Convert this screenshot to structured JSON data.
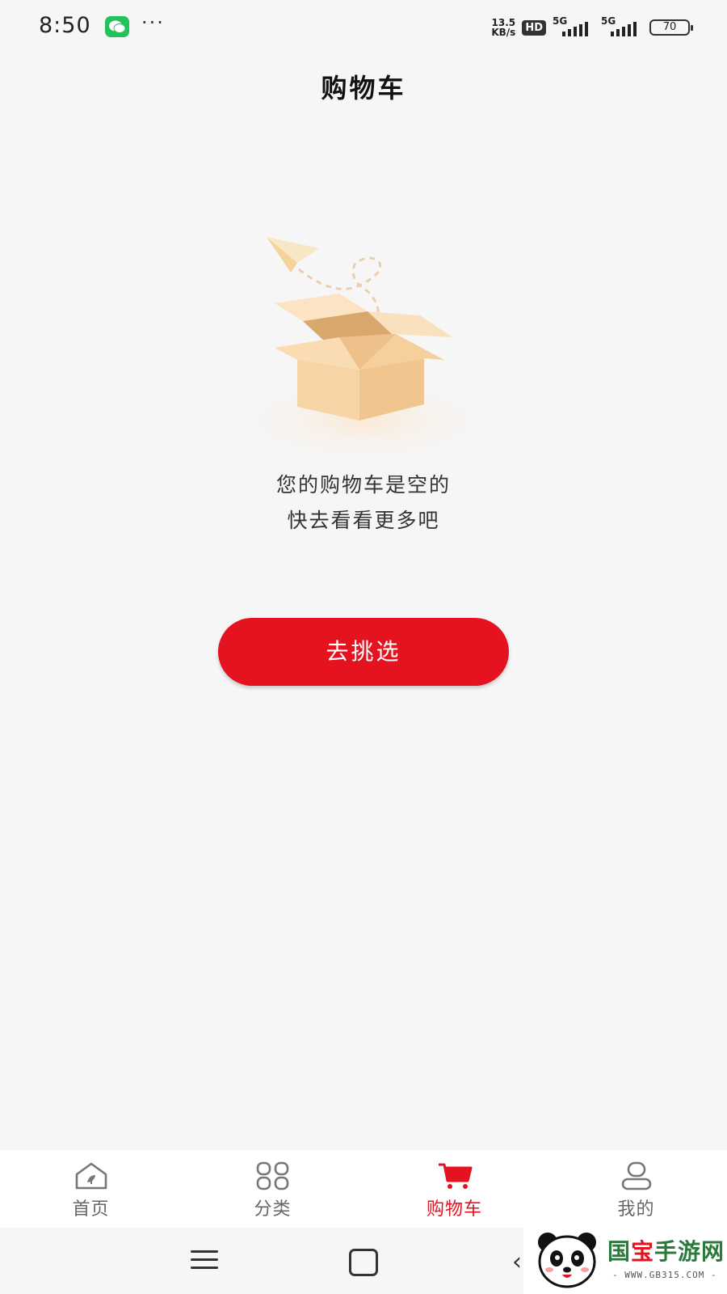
{
  "status_bar": {
    "time": "8:50",
    "more": "···",
    "net_speed_value": "13.5",
    "net_speed_unit": "KB/s",
    "hd_badge": "HD",
    "signal1_label": "5G",
    "signal2_label": "5G",
    "battery": "70"
  },
  "header": {
    "title": "购物车"
  },
  "empty_state": {
    "line1": "您的购物车是空的",
    "line2": "快去看看更多吧",
    "button_label": "去挑选"
  },
  "bottom_nav": {
    "items": [
      {
        "label": "首页",
        "icon": "home-icon",
        "active": false
      },
      {
        "label": "分类",
        "icon": "category-icon",
        "active": false
      },
      {
        "label": "购物车",
        "icon": "cart-icon",
        "active": true
      },
      {
        "label": "我的",
        "icon": "profile-icon",
        "active": false
      }
    ]
  },
  "watermark": {
    "title_part1": "国",
    "title_part2": "宝",
    "title_part3": "手游网",
    "subtitle": "- WWW.GB315.COM -"
  },
  "colors": {
    "accent": "#e5131f",
    "background": "#f6f6f6",
    "box": "#f6d4a6"
  }
}
